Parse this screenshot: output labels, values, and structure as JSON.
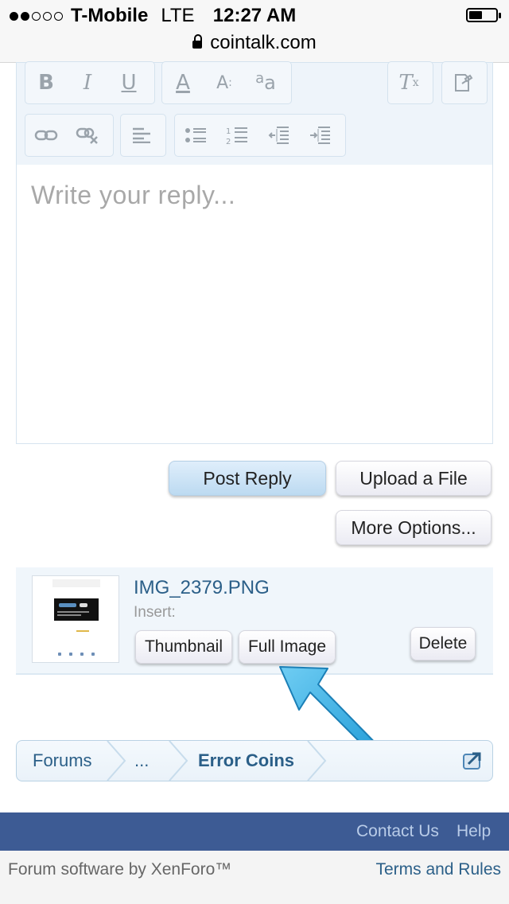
{
  "status_bar": {
    "carrier": "T-Mobile",
    "network": "LTE",
    "time": "12:27 AM",
    "url": "cointalk.com"
  },
  "editor": {
    "toolbar_icons": [
      "bold-icon",
      "italic-icon",
      "underline-icon",
      "font-color-icon",
      "font-size-icon",
      "font-family-icon",
      "remove-format-icon",
      "switch-mode-icon",
      "link-icon",
      "unlink-icon",
      "align-icon",
      "bullet-list-icon",
      "numbered-list-icon",
      "outdent-icon",
      "indent-icon"
    ],
    "placeholder": "Write your reply..."
  },
  "actions": {
    "post_reply": "Post Reply",
    "upload_file": "Upload a File",
    "more_options": "More Options..."
  },
  "attachment": {
    "filename": "IMG_2379.PNG",
    "insert_label": "Insert:",
    "thumbnail": "Thumbnail",
    "full_image": "Full Image",
    "delete": "Delete"
  },
  "breadcrumb": {
    "items": [
      "Forums",
      "...",
      "Error Coins"
    ]
  },
  "footer": {
    "contact": "Contact Us",
    "help": "Help",
    "copyright": "Forum software by XenForo™",
    "terms": "Terms and Rules"
  },
  "colors": {
    "footer_bar": "#3d5b94",
    "link": "#2b5f88",
    "arrow": "#29a8e0"
  }
}
